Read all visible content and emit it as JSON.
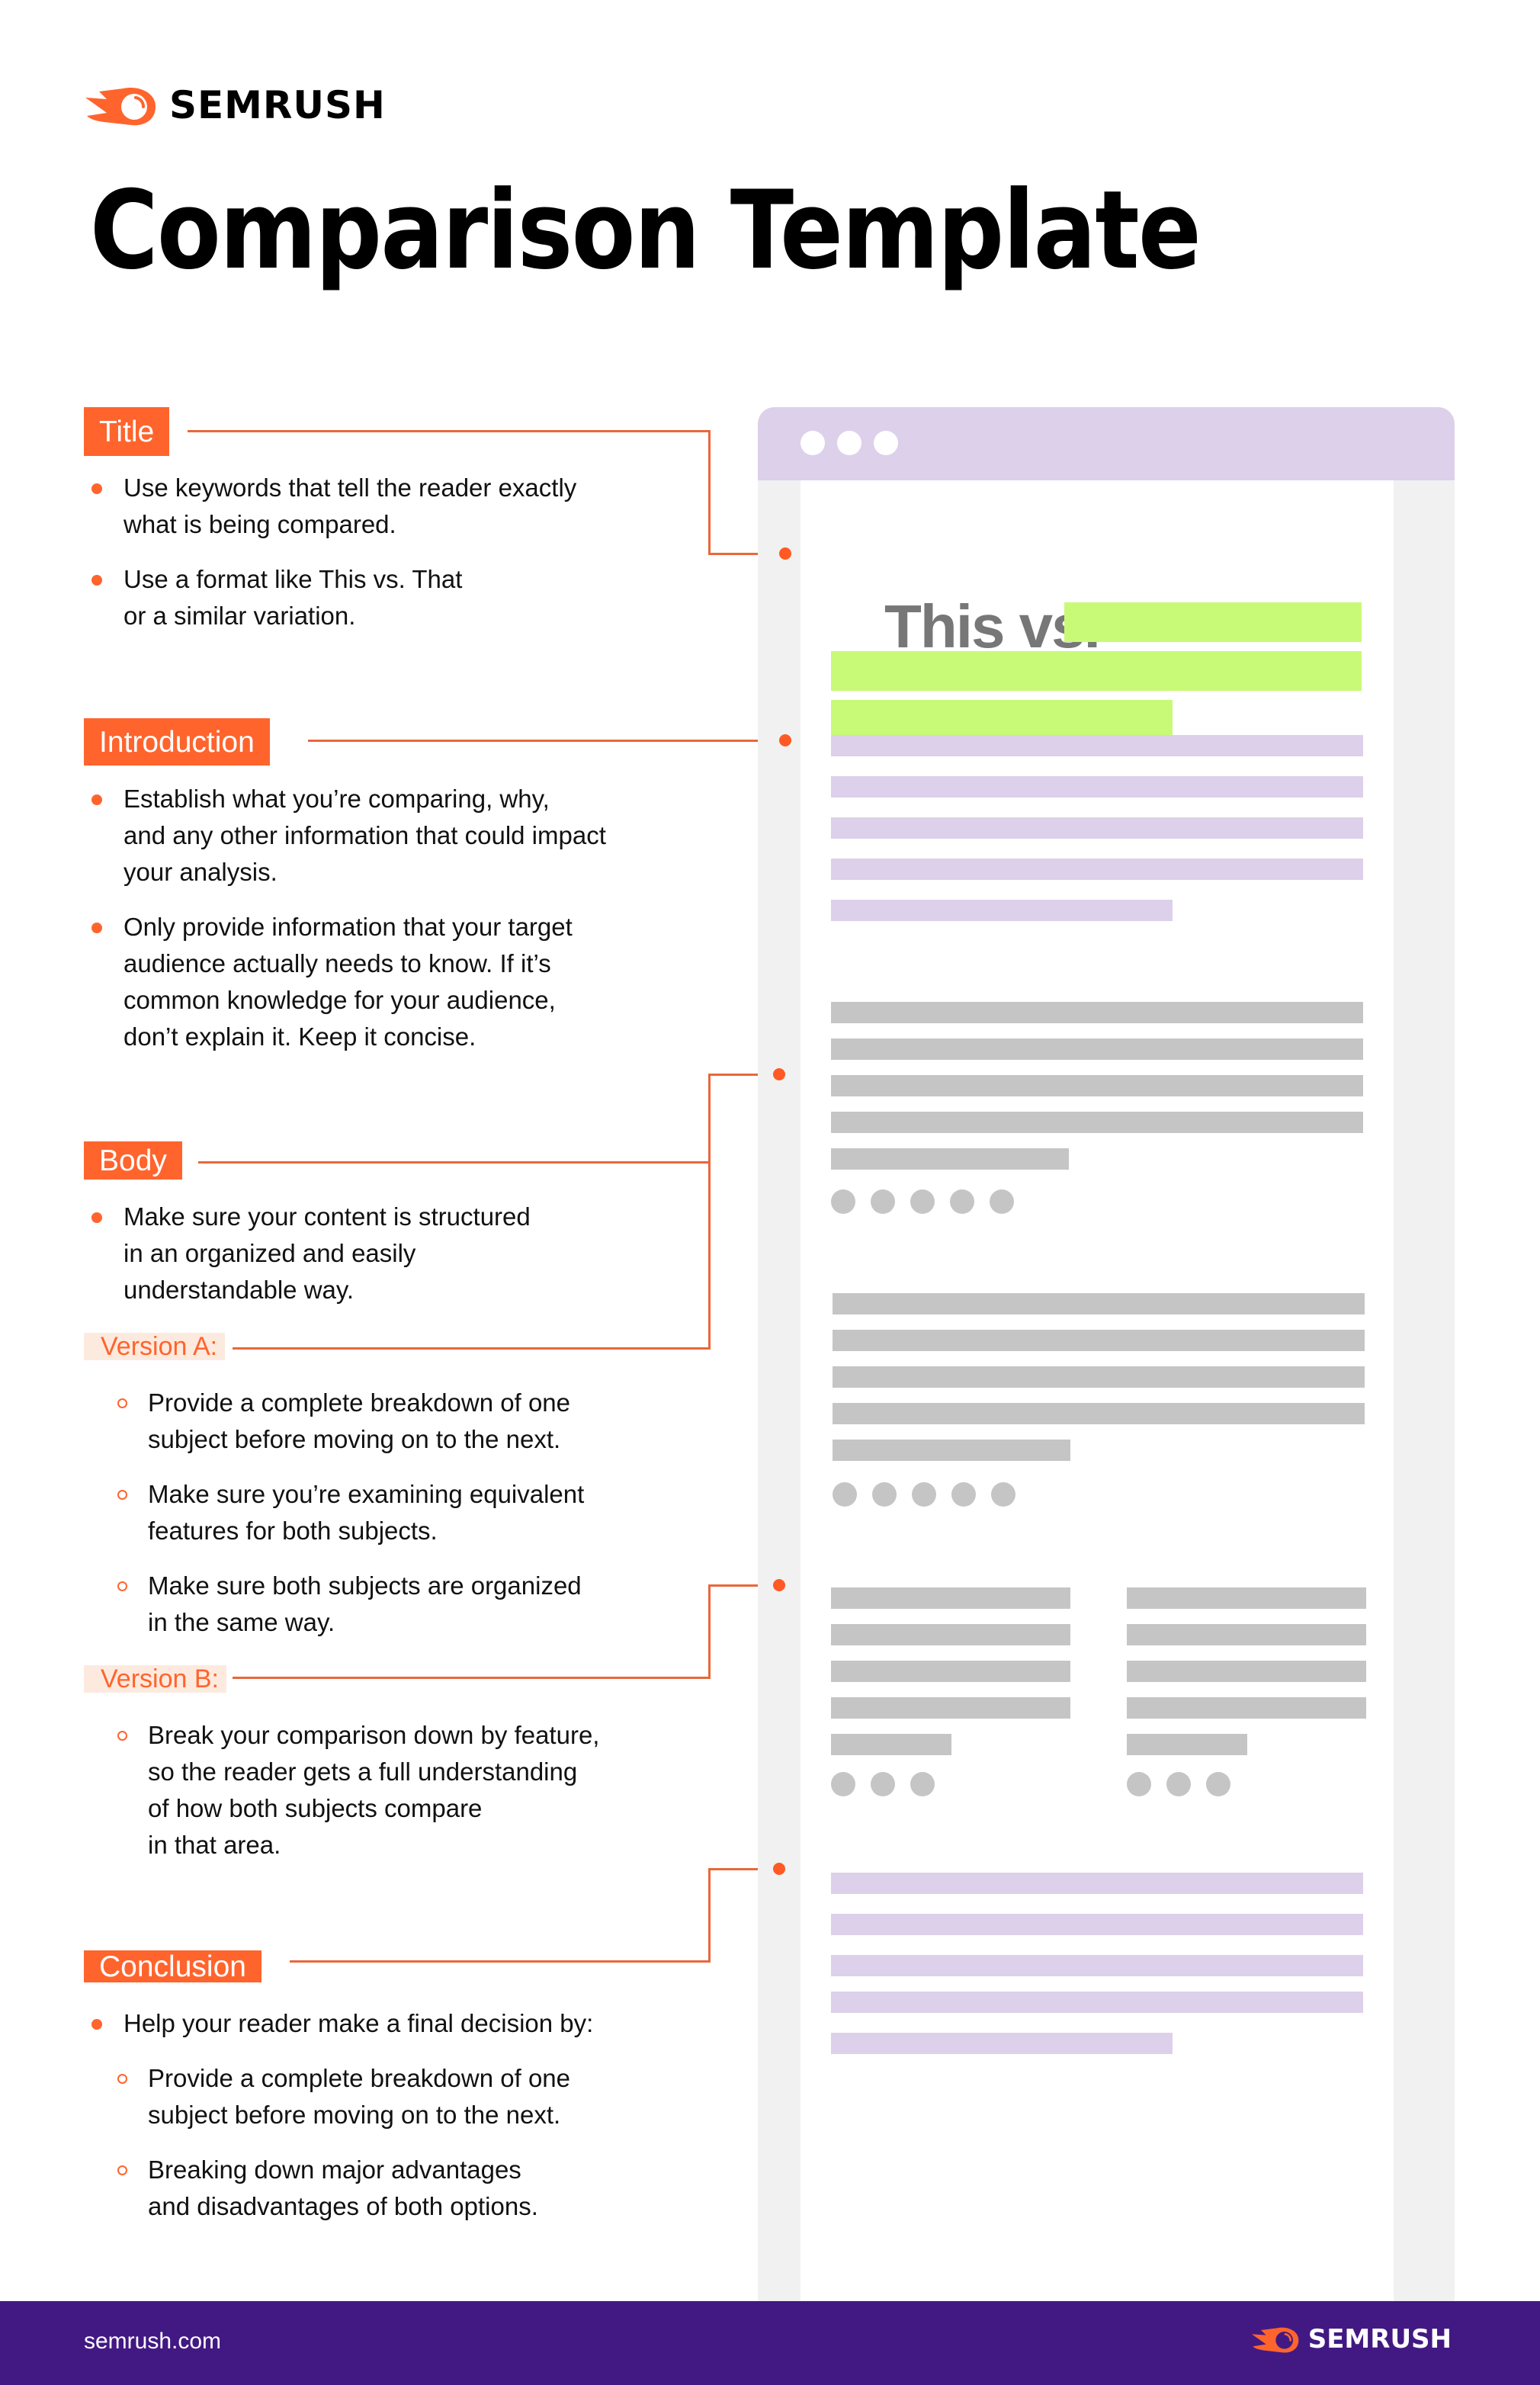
{
  "brand": {
    "name": "SEMRUSH",
    "accent": "#ff642d",
    "footer_bg": "#421983",
    "icon": "semrush-comet-icon"
  },
  "page_title": "Comparison Template",
  "sections": {
    "title": {
      "label": "Title",
      "bullets": [
        "Use keywords that tell the reader exactly\nwhat is being compared.",
        "Use a format like This vs. That\nor a similar variation."
      ]
    },
    "introduction": {
      "label": "Introduction",
      "bullets": [
        "Establish what you’re comparing, why,\nand any other information that could impact\nyour analysis.",
        "Only provide information that your target\naudience actually needs to know. If it’s\ncommon knowledge for your audience,\ndon’t explain it. Keep it concise."
      ]
    },
    "body": {
      "label": "Body",
      "bullets": [
        "Make sure your content is structured\nin an organized and easily\nunderstandable way."
      ],
      "version_a": {
        "label": "Version A:",
        "items": [
          "Provide a complete breakdown of one\nsubject before moving on to the next.",
          "Make sure you’re examining equivalent\nfeatures for both subjects.",
          "Make sure both subjects are organized\nin the same way."
        ]
      },
      "version_b": {
        "label": "Version B:",
        "items": [
          "Break your comparison down by feature,\nso the reader gets a full understanding\nof how both subjects compare\nin that area."
        ]
      }
    },
    "conclusion": {
      "label": "Conclusion",
      "bullets": [
        "Help your reader make a final decision by:"
      ],
      "items": [
        "Provide a complete breakdown of one\nsubject before moving on to the next.",
        "Breaking down major advantages\nand disadvantages of both options."
      ]
    }
  },
  "mockup": {
    "headline_text": "This vs.",
    "colors": {
      "titlebar": "#ddd0ea",
      "headline_highlight": "#c8fa78",
      "intro_lines": "#ddd0ea",
      "body_lines": "#c5c5c5"
    }
  },
  "footer": {
    "url": "semrush.com",
    "logo_text": "SEMRUSH"
  }
}
